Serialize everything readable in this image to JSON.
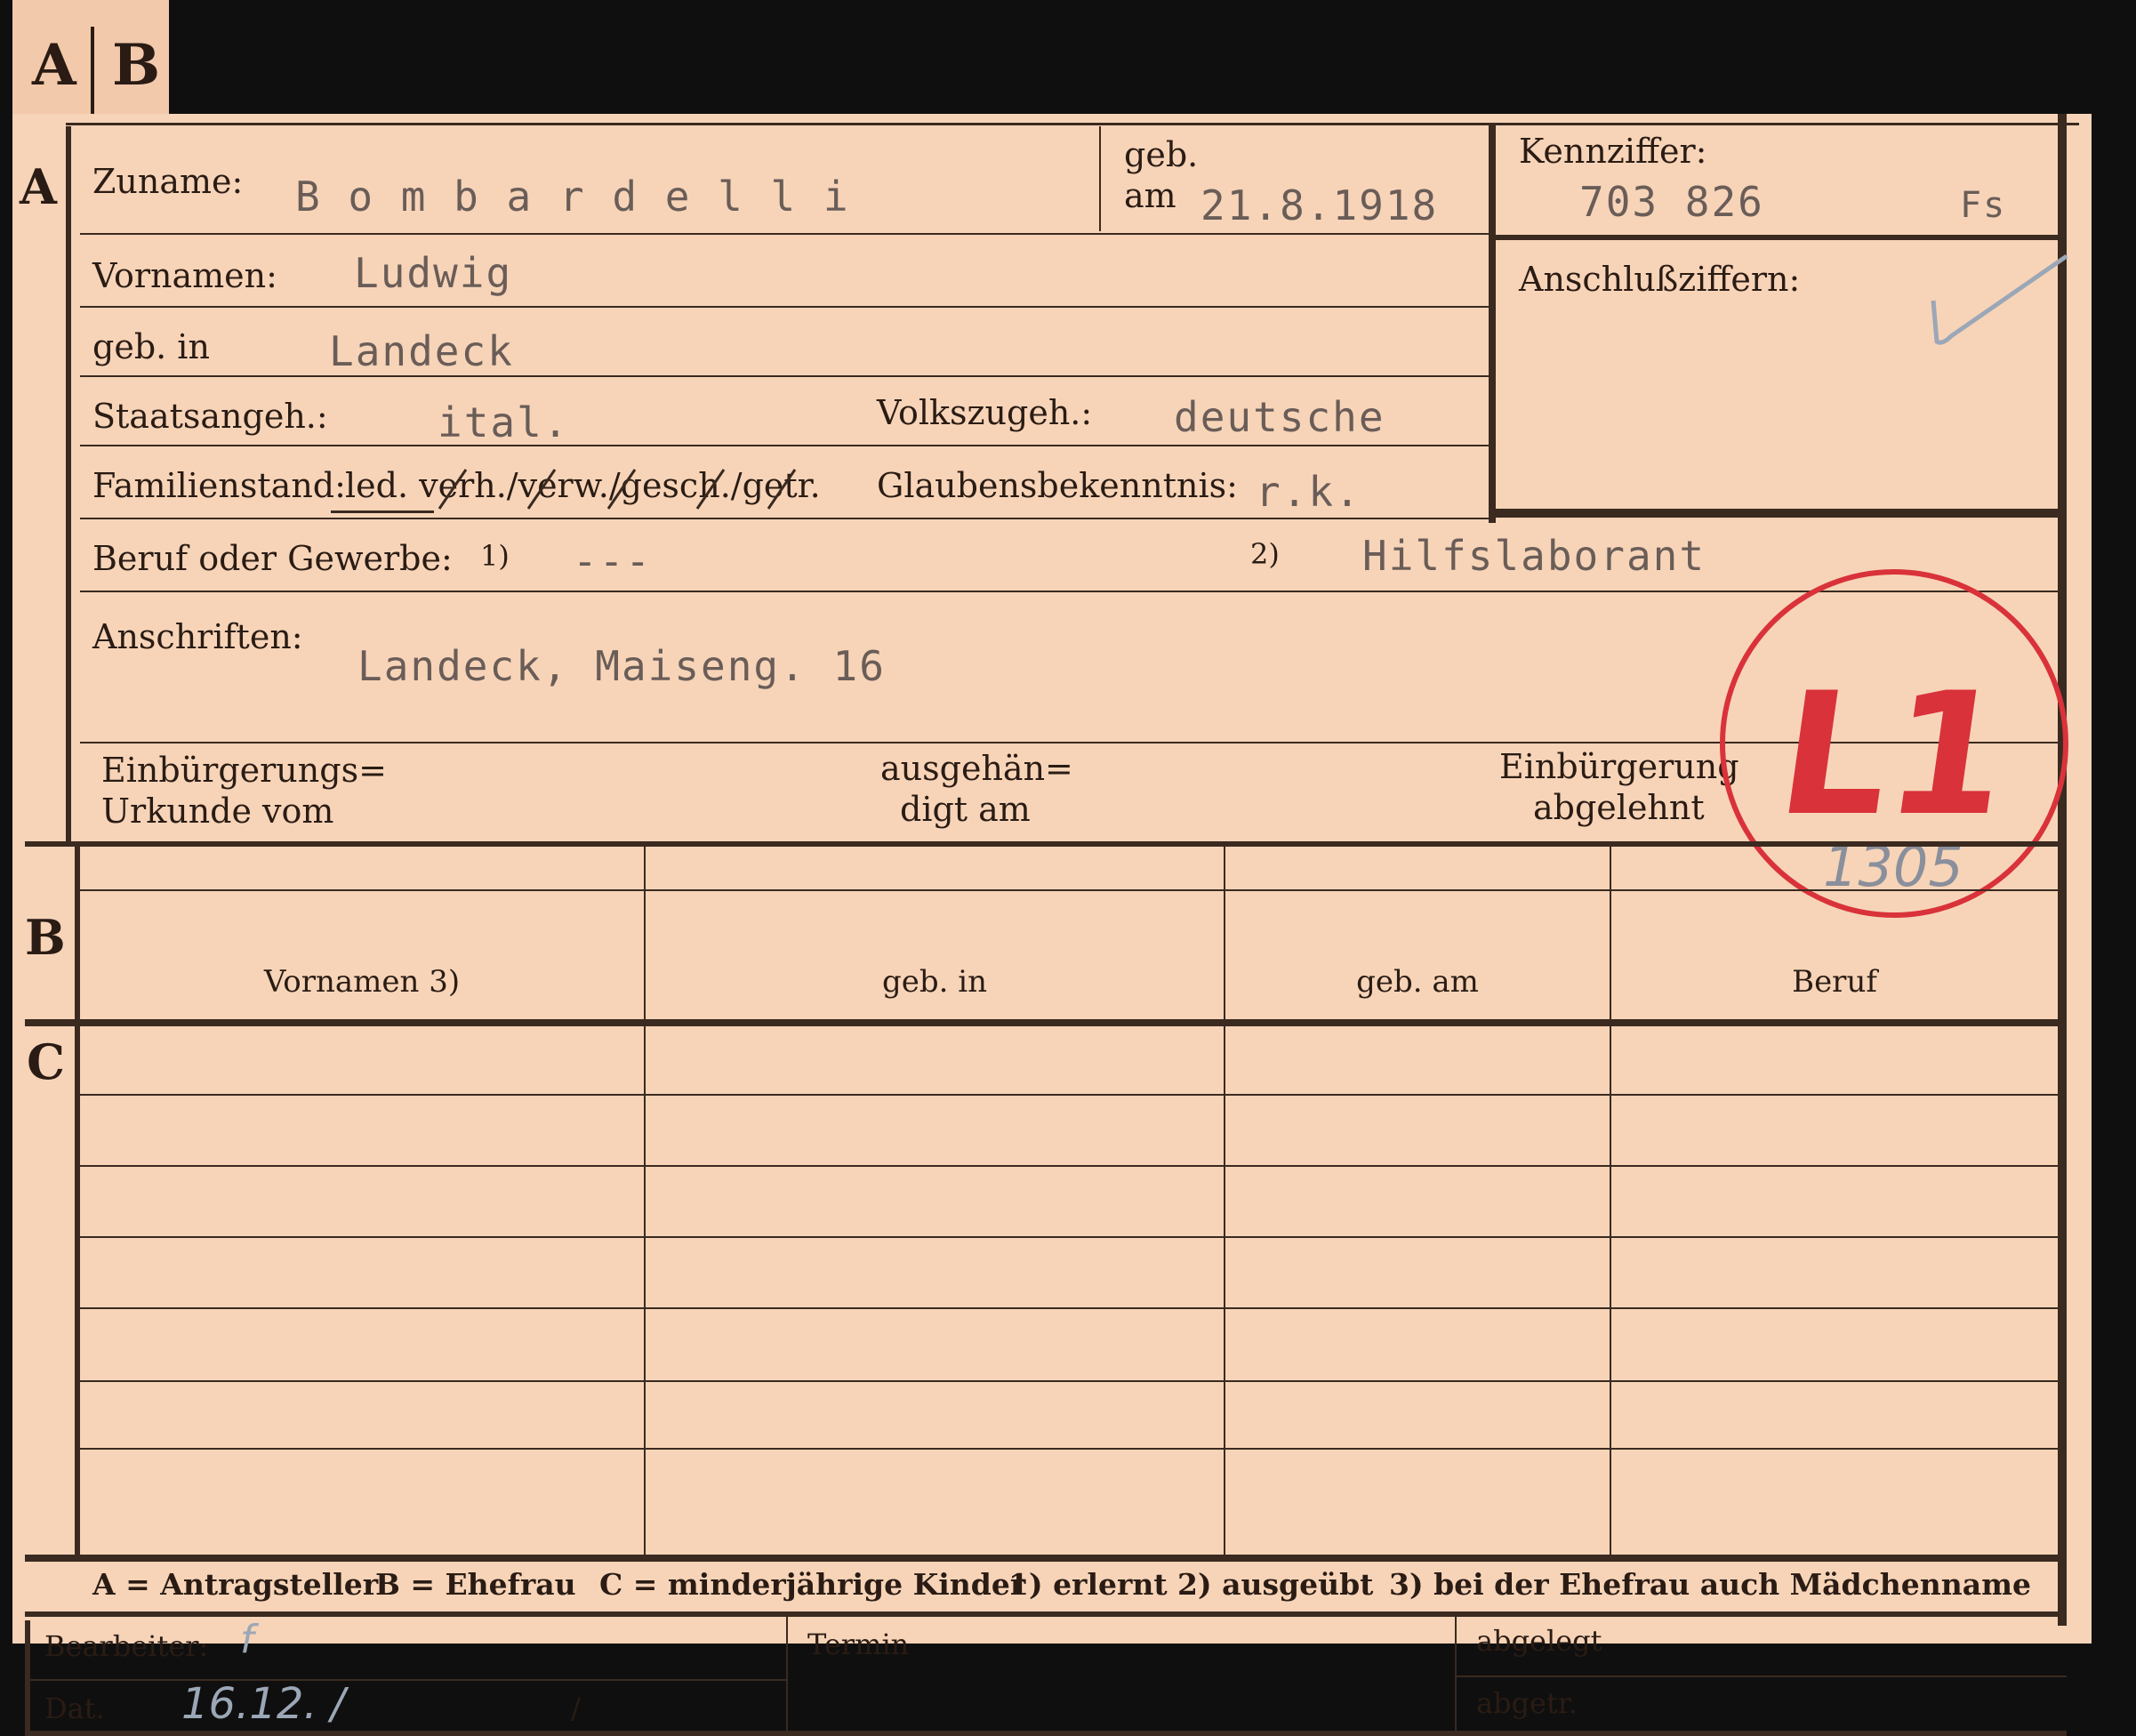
{
  "tab": {
    "a": "A",
    "b": "B"
  },
  "section_markers": {
    "a": "A",
    "b": "B",
    "c": "C"
  },
  "labels": {
    "zuname": "Zuname:",
    "geb": "geb.",
    "am": "am",
    "kennziffer": "Kennziffer:",
    "anschlussziffern": "Anschlußziffern:",
    "vornamen": "Vornamen:",
    "geb_in": "geb. in",
    "staatsangeh": "Staatsangeh.:",
    "volkszugeh": "Volkszugeh.:",
    "familienstand": "Familienstand:",
    "familienstand_options": "led. verh./verw./gesch./getr.",
    "glaubensbekenntnis": "Glaubensbekenntnis:",
    "beruf": "Beruf oder Gewerbe:",
    "beruf_note1": "1)",
    "beruf_note2": "2)",
    "anschriften": "Anschriften:",
    "einb_urkunde_1": "Einbürgerungs=",
    "einb_urkunde_2": "Urkunde vom",
    "ausgehaendigt_1": "ausgehän=",
    "ausgehaendigt_2": "digt am",
    "einb_abgelehnt_1": "Einbürgerung",
    "einb_abgelehnt_2": "abgelehnt"
  },
  "values": {
    "zuname": "B o m b a r d e l l i",
    "geb_am": "21.8.1918",
    "kennziffer": "703 826",
    "kennziffer_suffix": "Fs",
    "vornamen": "Ludwig",
    "geb_in": "Landeck",
    "staatsangeh": "ital.",
    "volkszugeh": "deutsche",
    "glaubensbekenntnis": "r.k.",
    "beruf_erlernt": "---",
    "beruf_ausgeuebt": "Hilfslaborant",
    "anschrift": "Landeck, Maiseng. 16"
  },
  "stamp": {
    "text": "L1",
    "handwritten": "1305"
  },
  "table": {
    "headers": [
      "Vornamen 3)",
      "geb. in",
      "geb. am",
      "Beruf"
    ]
  },
  "footer": {
    "legend_a": "A = Antragsteller",
    "legend_b": "B = Ehefrau",
    "legend_c": "C = minderjährige Kinder",
    "note1": "1) erlernt",
    "note2": "2) ausgeübt",
    "note3": "3) bei der Ehefrau auch Mädchenname"
  },
  "office": {
    "bearbeiter": "Bearbeiter:",
    "bearbeiter_value": "f",
    "dat": "Dat.",
    "dat_value": "16.12. /",
    "dat_slash": "/",
    "termin": "Termin",
    "abgelegt": "abgelegt",
    "abgetr": "abgetr."
  },
  "colors": {
    "card": "#f7d4b8",
    "ink": "#2a1c14",
    "stamp_red": "#d9323a",
    "typewriter": "#6a5d58"
  }
}
